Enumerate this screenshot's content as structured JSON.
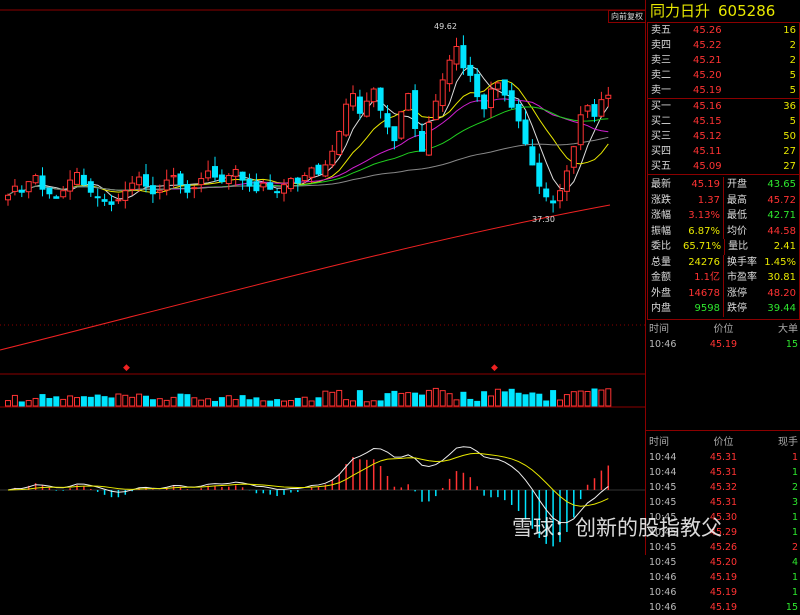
{
  "stock": {
    "name": "同力日升",
    "code": "605286"
  },
  "adjust_label": "向前复权",
  "chart_labels": {
    "high": "49.62",
    "low": "37.30"
  },
  "watermark": "雪球：创新的股指教父",
  "asks": [
    {
      "label": "卖五",
      "price": "45.26",
      "vol": "16"
    },
    {
      "label": "卖四",
      "price": "45.22",
      "vol": "2"
    },
    {
      "label": "卖三",
      "price": "45.21",
      "vol": "2"
    },
    {
      "label": "卖二",
      "price": "45.20",
      "vol": "5"
    },
    {
      "label": "卖一",
      "price": "45.19",
      "vol": "5"
    }
  ],
  "bids": [
    {
      "label": "买一",
      "price": "45.16",
      "vol": "36"
    },
    {
      "label": "买二",
      "price": "45.15",
      "vol": "5"
    },
    {
      "label": "买三",
      "price": "45.12",
      "vol": "50"
    },
    {
      "label": "买四",
      "price": "45.11",
      "vol": "27"
    },
    {
      "label": "买五",
      "price": "45.09",
      "vol": "27"
    }
  ],
  "quote": [
    [
      {
        "k": "最新",
        "v": "45.19",
        "c": "r"
      },
      {
        "k": "开盘",
        "v": "43.65",
        "c": "g"
      }
    ],
    [
      {
        "k": "涨跌",
        "v": "1.37",
        "c": "r"
      },
      {
        "k": "最高",
        "v": "45.72",
        "c": "r"
      }
    ],
    [
      {
        "k": "涨幅",
        "v": "3.13%",
        "c": "r"
      },
      {
        "k": "最低",
        "v": "42.71",
        "c": "g"
      }
    ],
    [
      {
        "k": "振幅",
        "v": "6.87%",
        "c": "y"
      },
      {
        "k": "均价",
        "v": "44.58",
        "c": "r"
      }
    ],
    [
      {
        "k": "委比",
        "v": "65.71%",
        "c": "y"
      },
      {
        "k": "量比",
        "v": "2.41",
        "c": "y"
      }
    ],
    [
      {
        "k": "总量",
        "v": "24276",
        "c": "y"
      },
      {
        "k": "换手率",
        "v": "1.45%",
        "c": "y"
      }
    ],
    [
      {
        "k": "金额",
        "v": "1.1亿",
        "c": "r"
      },
      {
        "k": "市盈率",
        "v": "30.81",
        "c": "y"
      }
    ],
    [
      {
        "k": "外盘",
        "v": "14678",
        "c": "r"
      },
      {
        "k": "涨停",
        "v": "48.20",
        "c": "r"
      }
    ],
    [
      {
        "k": "内盘",
        "v": "9598",
        "c": "g"
      },
      {
        "k": "跌停",
        "v": "39.44",
        "c": "g"
      }
    ]
  ],
  "bigorder": {
    "headers": [
      "时间",
      "价位",
      "大单"
    ],
    "rows": [
      {
        "t": "10:46",
        "p": "45.19",
        "v": "15"
      }
    ]
  },
  "ticks": {
    "headers": [
      "时间",
      "价位",
      "现手"
    ],
    "rows": [
      {
        "t": "10:44",
        "p": "45.31",
        "v": "1",
        "c": "r"
      },
      {
        "t": "10:44",
        "p": "45.31",
        "v": "1",
        "c": "g"
      },
      {
        "t": "10:45",
        "p": "45.32",
        "v": "2",
        "c": "g"
      },
      {
        "t": "10:45",
        "p": "45.31",
        "v": "3",
        "c": "g"
      },
      {
        "t": "10:45",
        "p": "45.30",
        "v": "1",
        "c": "g"
      },
      {
        "t": "10:45",
        "p": "45.29",
        "v": "1",
        "c": "g"
      },
      {
        "t": "10:45",
        "p": "45.26",
        "v": "2",
        "c": "r"
      },
      {
        "t": "10:45",
        "p": "45.20",
        "v": "4",
        "c": "g"
      },
      {
        "t": "10:46",
        "p": "45.19",
        "v": "1",
        "c": "g"
      },
      {
        "t": "10:46",
        "p": "45.19",
        "v": "1",
        "c": "g"
      },
      {
        "t": "10:46",
        "p": "45.19",
        "v": "15",
        "c": "g"
      }
    ]
  },
  "chart_data": {
    "type": "candlestick",
    "closes": [
      38.6,
      39.2,
      38.8,
      39.5,
      39.9,
      39.0,
      38.7,
      38.4,
      38.9,
      39.6,
      40.1,
      39.3,
      38.8,
      38.5,
      38.2,
      38.0,
      38.3,
      38.9,
      39.4,
      39.8,
      39.2,
      38.7,
      38.9,
      39.6,
      39.9,
      39.3,
      38.8,
      39.1,
      39.7,
      40.2,
      39.8,
      39.5,
      39.9,
      40.3,
      39.6,
      39.2,
      38.9,
      39.4,
      39.0,
      38.8,
      39.3,
      39.7,
      39.4,
      39.9,
      40.4,
      40.0,
      40.6,
      41.5,
      42.8,
      44.6,
      45.3,
      44.0,
      44.8,
      45.6,
      44.2,
      43.1,
      42.2,
      44.1,
      45.3,
      43.0,
      41.5,
      43.4,
      44.8,
      46.2,
      47.5,
      48.4,
      47.0,
      46.5,
      45.1,
      44.3,
      45.6,
      46.0,
      45.2,
      44.4,
      43.5,
      42.0,
      40.6,
      39.2,
      38.5,
      38.1,
      38.9,
      40.2,
      41.8,
      43.9,
      44.5,
      43.8,
      44.9,
      45.19
    ],
    "ylim": [
      33,
      51
    ],
    "high": 49.62,
    "low": 37.3
  }
}
